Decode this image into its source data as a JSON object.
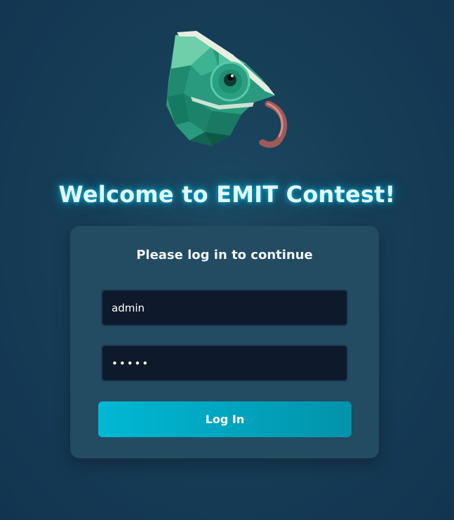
{
  "app": {
    "logo_icon": "chameleon-logo-icon"
  },
  "header": {
    "title": "Welcome to EMIT Contest!"
  },
  "login": {
    "heading": "Please log in to continue",
    "username_value": "admin",
    "password_value": "•••••",
    "submit_label": "Log In"
  },
  "colors": {
    "background": "#173e57",
    "card": "#234b61",
    "input": "#0e1a2b",
    "accent": "#01b8d4",
    "title_glow": "#00c8e6"
  }
}
